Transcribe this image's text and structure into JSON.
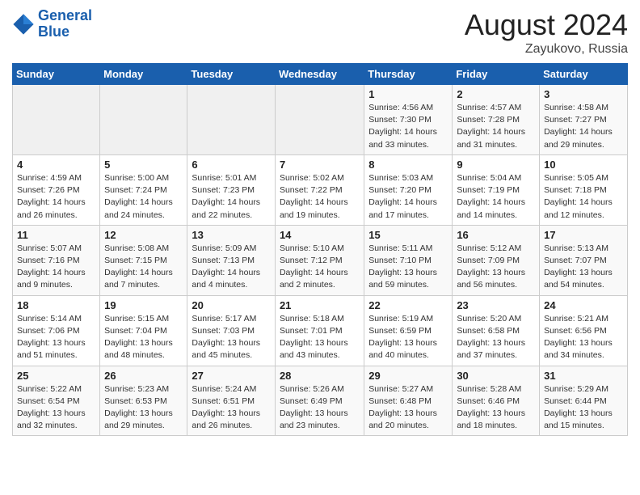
{
  "logo": {
    "line1": "General",
    "line2": "Blue"
  },
  "title": "August 2024",
  "location": "Zayukovo, Russia",
  "weekdays": [
    "Sunday",
    "Monday",
    "Tuesday",
    "Wednesday",
    "Thursday",
    "Friday",
    "Saturday"
  ],
  "weeks": [
    [
      {
        "day": "",
        "info": ""
      },
      {
        "day": "",
        "info": ""
      },
      {
        "day": "",
        "info": ""
      },
      {
        "day": "",
        "info": ""
      },
      {
        "day": "1",
        "info": "Sunrise: 4:56 AM\nSunset: 7:30 PM\nDaylight: 14 hours\nand 33 minutes."
      },
      {
        "day": "2",
        "info": "Sunrise: 4:57 AM\nSunset: 7:28 PM\nDaylight: 14 hours\nand 31 minutes."
      },
      {
        "day": "3",
        "info": "Sunrise: 4:58 AM\nSunset: 7:27 PM\nDaylight: 14 hours\nand 29 minutes."
      }
    ],
    [
      {
        "day": "4",
        "info": "Sunrise: 4:59 AM\nSunset: 7:26 PM\nDaylight: 14 hours\nand 26 minutes."
      },
      {
        "day": "5",
        "info": "Sunrise: 5:00 AM\nSunset: 7:24 PM\nDaylight: 14 hours\nand 24 minutes."
      },
      {
        "day": "6",
        "info": "Sunrise: 5:01 AM\nSunset: 7:23 PM\nDaylight: 14 hours\nand 22 minutes."
      },
      {
        "day": "7",
        "info": "Sunrise: 5:02 AM\nSunset: 7:22 PM\nDaylight: 14 hours\nand 19 minutes."
      },
      {
        "day": "8",
        "info": "Sunrise: 5:03 AM\nSunset: 7:20 PM\nDaylight: 14 hours\nand 17 minutes."
      },
      {
        "day": "9",
        "info": "Sunrise: 5:04 AM\nSunset: 7:19 PM\nDaylight: 14 hours\nand 14 minutes."
      },
      {
        "day": "10",
        "info": "Sunrise: 5:05 AM\nSunset: 7:18 PM\nDaylight: 14 hours\nand 12 minutes."
      }
    ],
    [
      {
        "day": "11",
        "info": "Sunrise: 5:07 AM\nSunset: 7:16 PM\nDaylight: 14 hours\nand 9 minutes."
      },
      {
        "day": "12",
        "info": "Sunrise: 5:08 AM\nSunset: 7:15 PM\nDaylight: 14 hours\nand 7 minutes."
      },
      {
        "day": "13",
        "info": "Sunrise: 5:09 AM\nSunset: 7:13 PM\nDaylight: 14 hours\nand 4 minutes."
      },
      {
        "day": "14",
        "info": "Sunrise: 5:10 AM\nSunset: 7:12 PM\nDaylight: 14 hours\nand 2 minutes."
      },
      {
        "day": "15",
        "info": "Sunrise: 5:11 AM\nSunset: 7:10 PM\nDaylight: 13 hours\nand 59 minutes."
      },
      {
        "day": "16",
        "info": "Sunrise: 5:12 AM\nSunset: 7:09 PM\nDaylight: 13 hours\nand 56 minutes."
      },
      {
        "day": "17",
        "info": "Sunrise: 5:13 AM\nSunset: 7:07 PM\nDaylight: 13 hours\nand 54 minutes."
      }
    ],
    [
      {
        "day": "18",
        "info": "Sunrise: 5:14 AM\nSunset: 7:06 PM\nDaylight: 13 hours\nand 51 minutes."
      },
      {
        "day": "19",
        "info": "Sunrise: 5:15 AM\nSunset: 7:04 PM\nDaylight: 13 hours\nand 48 minutes."
      },
      {
        "day": "20",
        "info": "Sunrise: 5:17 AM\nSunset: 7:03 PM\nDaylight: 13 hours\nand 45 minutes."
      },
      {
        "day": "21",
        "info": "Sunrise: 5:18 AM\nSunset: 7:01 PM\nDaylight: 13 hours\nand 43 minutes."
      },
      {
        "day": "22",
        "info": "Sunrise: 5:19 AM\nSunset: 6:59 PM\nDaylight: 13 hours\nand 40 minutes."
      },
      {
        "day": "23",
        "info": "Sunrise: 5:20 AM\nSunset: 6:58 PM\nDaylight: 13 hours\nand 37 minutes."
      },
      {
        "day": "24",
        "info": "Sunrise: 5:21 AM\nSunset: 6:56 PM\nDaylight: 13 hours\nand 34 minutes."
      }
    ],
    [
      {
        "day": "25",
        "info": "Sunrise: 5:22 AM\nSunset: 6:54 PM\nDaylight: 13 hours\nand 32 minutes."
      },
      {
        "day": "26",
        "info": "Sunrise: 5:23 AM\nSunset: 6:53 PM\nDaylight: 13 hours\nand 29 minutes."
      },
      {
        "day": "27",
        "info": "Sunrise: 5:24 AM\nSunset: 6:51 PM\nDaylight: 13 hours\nand 26 minutes."
      },
      {
        "day": "28",
        "info": "Sunrise: 5:26 AM\nSunset: 6:49 PM\nDaylight: 13 hours\nand 23 minutes."
      },
      {
        "day": "29",
        "info": "Sunrise: 5:27 AM\nSunset: 6:48 PM\nDaylight: 13 hours\nand 20 minutes."
      },
      {
        "day": "30",
        "info": "Sunrise: 5:28 AM\nSunset: 6:46 PM\nDaylight: 13 hours\nand 18 minutes."
      },
      {
        "day": "31",
        "info": "Sunrise: 5:29 AM\nSunset: 6:44 PM\nDaylight: 13 hours\nand 15 minutes."
      }
    ]
  ]
}
